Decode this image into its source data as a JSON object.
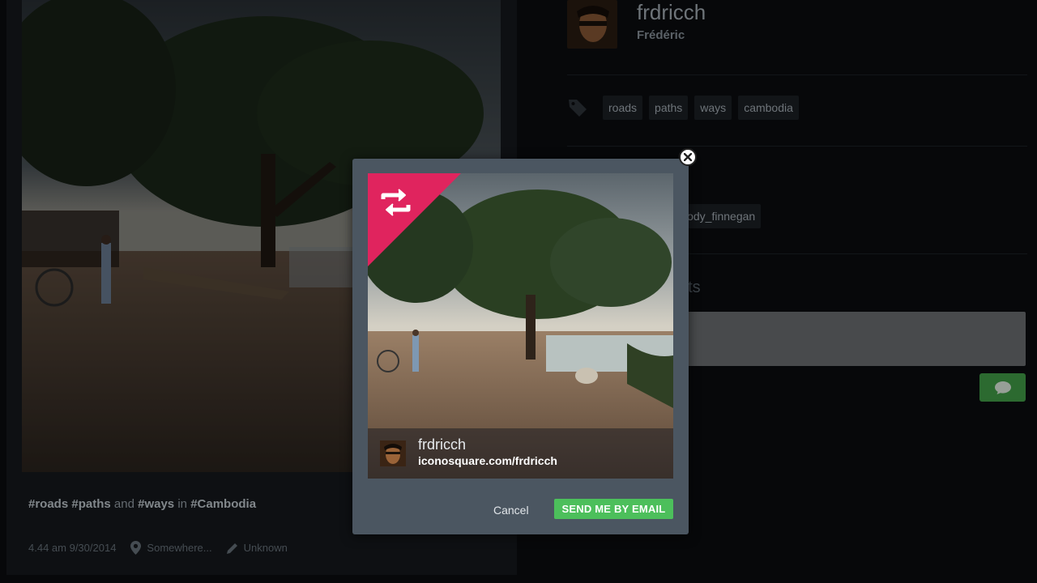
{
  "post": {
    "caption_tag1": "#roads",
    "caption_tag2": "#paths",
    "caption_and": "and",
    "caption_tag3": "#ways",
    "caption_in": "in",
    "caption_tag4": "#Cambodia",
    "timestamp": "4.44 am 9/30/2014",
    "location": "Somewhere...",
    "filter": "Unknown"
  },
  "profile": {
    "username": "frdricch",
    "fullname": "Frédéric"
  },
  "tags": [
    "roads",
    "paths",
    "ways",
    "cambodia"
  ],
  "mention": "lody_finnegan",
  "comments_title": "nts",
  "modal": {
    "preview_username": "frdricch",
    "preview_url": "iconosquare.com/frdricch",
    "cancel_label": "Cancel",
    "send_label": "SEND ME BY EMAIL"
  },
  "colors": {
    "ribbon": "#e0245e",
    "send": "#4cbf5b",
    "comment_button": "#44a34b"
  }
}
